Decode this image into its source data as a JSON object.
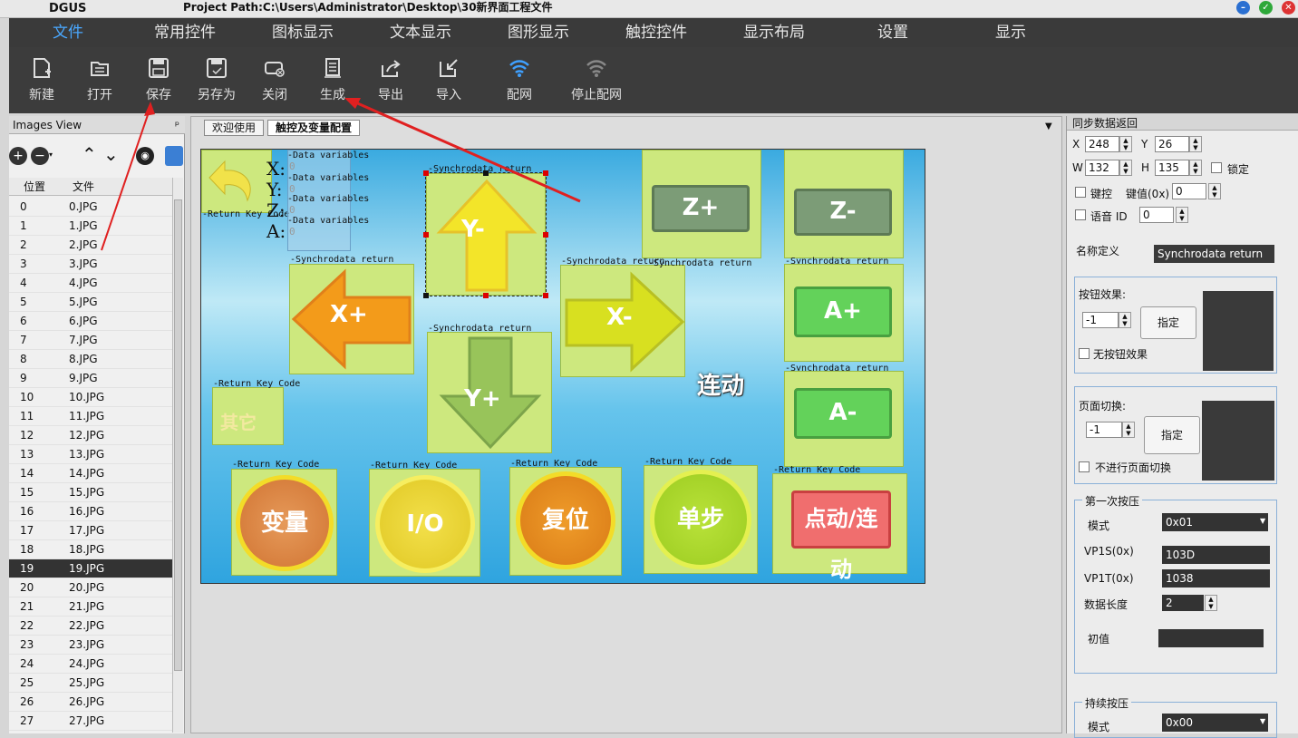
{
  "titlebar": {
    "app": "DGUS",
    "path": "Project Path:C:\\Users\\Administrator\\Desktop\\30新界面工程文件"
  },
  "menu": [
    "文件",
    "常用控件",
    "图标显示",
    "文本显示",
    "图形显示",
    "触控控件",
    "显示布局",
    "设置",
    "显示"
  ],
  "toolbar": [
    {
      "label": "新建",
      "icon": "new-file-icon"
    },
    {
      "label": "打开",
      "icon": "open-folder-icon"
    },
    {
      "label": "保存",
      "icon": "save-icon"
    },
    {
      "label": "另存为",
      "icon": "save-as-icon"
    },
    {
      "label": "关闭",
      "icon": "close-file-icon"
    },
    {
      "label": "生成",
      "icon": "generate-icon"
    },
    {
      "label": "导出",
      "icon": "export-icon"
    },
    {
      "label": "导入",
      "icon": "import-icon"
    },
    {
      "label": "配网",
      "icon": "wifi-icon"
    },
    {
      "label": "停止配网",
      "icon": "wifi-off-icon"
    }
  ],
  "images_view": {
    "title": "Images View",
    "pin": "ᵖ",
    "col_pos": "位置",
    "col_file": "文件",
    "rows": [
      [
        "0",
        "0.JPG"
      ],
      [
        "1",
        "1.JPG"
      ],
      [
        "2",
        "2.JPG"
      ],
      [
        "3",
        "3.JPG"
      ],
      [
        "4",
        "4.JPG"
      ],
      [
        "5",
        "5.JPG"
      ],
      [
        "6",
        "6.JPG"
      ],
      [
        "7",
        "7.JPG"
      ],
      [
        "8",
        "8.JPG"
      ],
      [
        "9",
        "9.JPG"
      ],
      [
        "10",
        "10.JPG"
      ],
      [
        "11",
        "11.JPG"
      ],
      [
        "12",
        "12.JPG"
      ],
      [
        "13",
        "13.JPG"
      ],
      [
        "14",
        "14.JPG"
      ],
      [
        "15",
        "15.JPG"
      ],
      [
        "16",
        "16.JPG"
      ],
      [
        "17",
        "17.JPG"
      ],
      [
        "18",
        "18.JPG"
      ],
      [
        "19",
        "19.JPG"
      ],
      [
        "20",
        "20.JPG"
      ],
      [
        "21",
        "21.JPG"
      ],
      [
        "22",
        "22.JPG"
      ],
      [
        "23",
        "23.JPG"
      ],
      [
        "24",
        "24.JPG"
      ],
      [
        "25",
        "25.JPG"
      ],
      [
        "26",
        "26.JPG"
      ],
      [
        "27",
        "27.JPG"
      ]
    ],
    "selected": "19"
  },
  "tabs": [
    "欢迎使用",
    "触控及变量配置"
  ],
  "canvas": {
    "dv_label": "-Data variables",
    "dv_value": "0",
    "axis_letters": [
      "X:",
      "Y:",
      "Z:",
      "A:"
    ],
    "rkc_label": "-Return Key Code",
    "sync_label": "-Synchrodata return",
    "btn_zplus": "Z+",
    "btn_zminus": "Z-",
    "btn_aplus": "A+",
    "btn_aminus": "A-",
    "btn_xplus": "X+",
    "btn_xminus": "X-",
    "btn_yminus": "Y-",
    "btn_yplus": "Y+",
    "other": "其它",
    "linkage": "连动",
    "btn_var": "变量",
    "btn_io": "I/O",
    "btn_reset": "复位",
    "btn_step": "单步",
    "btn_jog": "点动/连动"
  },
  "right": {
    "title": "同步数据返回",
    "x_label": "X",
    "x": "248",
    "y_label": "Y",
    "y": "26",
    "w_label": "W",
    "w": "132",
    "h_label": "H",
    "h": "135",
    "lock": "锁定",
    "keyctrl": "键控",
    "keyval_label": "键值(0x)",
    "keyval": "0",
    "voice": "语音 ID",
    "voice_val": "0",
    "name_label": "名称定义",
    "name": "Synchrodata return",
    "btn_effect": "按钮效果:",
    "btn_effect_val": "-1",
    "assign": "指定",
    "no_btn_effect": "无按钮效果",
    "page_switch": "页面切换:",
    "page_switch_val": "-1",
    "no_page_switch": "不进行页面切换",
    "first_press": "第一次按压",
    "mode": "模式",
    "mode_val": "0x01",
    "vp1s": "VP1S(0x)",
    "vp1s_val": "103D",
    "vp1t": "VP1T(0x)",
    "vp1t_val": "1038",
    "datalen": "数据长度",
    "datalen_val": "2",
    "initval": "初值",
    "cont_press": "持续按压",
    "mode2": "模式",
    "mode2_val": "0x00"
  }
}
